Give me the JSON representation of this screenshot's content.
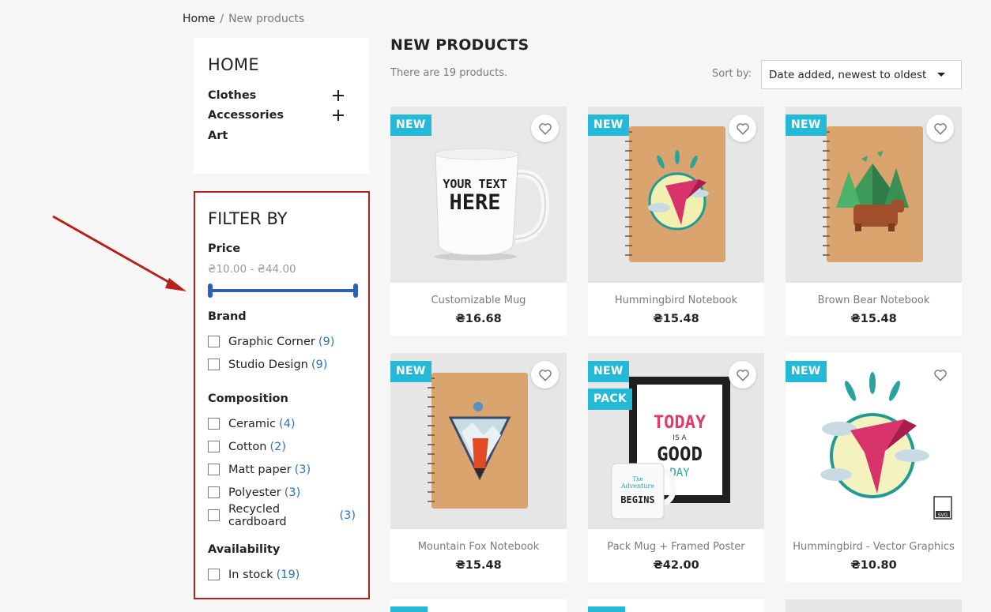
{
  "breadcrumb": {
    "home": "Home",
    "separator": "/",
    "current": "New products"
  },
  "category_block": {
    "title": "HOME",
    "items": [
      {
        "label": "Clothes",
        "expandable": true
      },
      {
        "label": "Accessories",
        "expandable": true
      },
      {
        "label": "Art",
        "expandable": false
      }
    ]
  },
  "filter_block": {
    "title": "FILTER BY",
    "price": {
      "label": "Price",
      "range_text": "₴10.00 - ₴44.00",
      "min": 10.0,
      "max": 44.0
    },
    "facets": [
      {
        "label": "Brand",
        "options": [
          {
            "label": "Graphic Corner",
            "count": "(9)"
          },
          {
            "label": "Studio Design",
            "count": "(9)"
          }
        ]
      },
      {
        "label": "Composition",
        "options": [
          {
            "label": "Ceramic",
            "count": "(4)"
          },
          {
            "label": "Cotton",
            "count": "(2)"
          },
          {
            "label": "Matt paper",
            "count": "(3)"
          },
          {
            "label": "Polyester",
            "count": "(3)"
          },
          {
            "label": "Recycled cardboard",
            "count": "(3)"
          }
        ]
      },
      {
        "label": "Availability",
        "options": [
          {
            "label": "In stock",
            "count": "(19)"
          }
        ]
      }
    ]
  },
  "products_header": {
    "title": "NEW PRODUCTS",
    "count_text": "There are 19 products.",
    "sort_label": "Sort by:",
    "sort_value": "Date added, newest to oldest"
  },
  "products": [
    {
      "name": "Customizable Mug",
      "price": "₴16.68",
      "badges": [
        "NEW"
      ],
      "image": "mug-image"
    },
    {
      "name": "Hummingbird Notebook",
      "price": "₴15.48",
      "badges": [
        "NEW"
      ],
      "image": "hummingbird-notebook-image"
    },
    {
      "name": "Brown Bear Notebook",
      "price": "₴15.48",
      "badges": [
        "NEW"
      ],
      "image": "bear-notebook-image"
    },
    {
      "name": "Mountain Fox Notebook",
      "price": "₴15.48",
      "badges": [
        "NEW"
      ],
      "image": "fox-notebook-image"
    },
    {
      "name": "Pack Mug + Framed Poster",
      "price": "₴42.00",
      "badges": [
        "NEW",
        "PACK"
      ],
      "image": "pack-poster-image"
    },
    {
      "name": "Hummingbird - Vector Graphics",
      "price": "₴10.80",
      "badges": [
        "NEW"
      ],
      "image": "hummingbird-vector-image"
    }
  ],
  "mug_text": [
    "YOUR TEXT",
    "HERE"
  ],
  "poster_text": [
    "TODAY",
    "IS A",
    "GOOD",
    "DAY"
  ],
  "small_mug_text": [
    "The",
    "Adventure",
    "BEGINS"
  ],
  "file_icon_label": "SVG",
  "colors": {
    "badge": "#24b9d7",
    "accent_blue": "#2d5fbf",
    "filter_border": "#b8211b",
    "arrow": "#b8211b",
    "count_link": "#2d74ba"
  }
}
